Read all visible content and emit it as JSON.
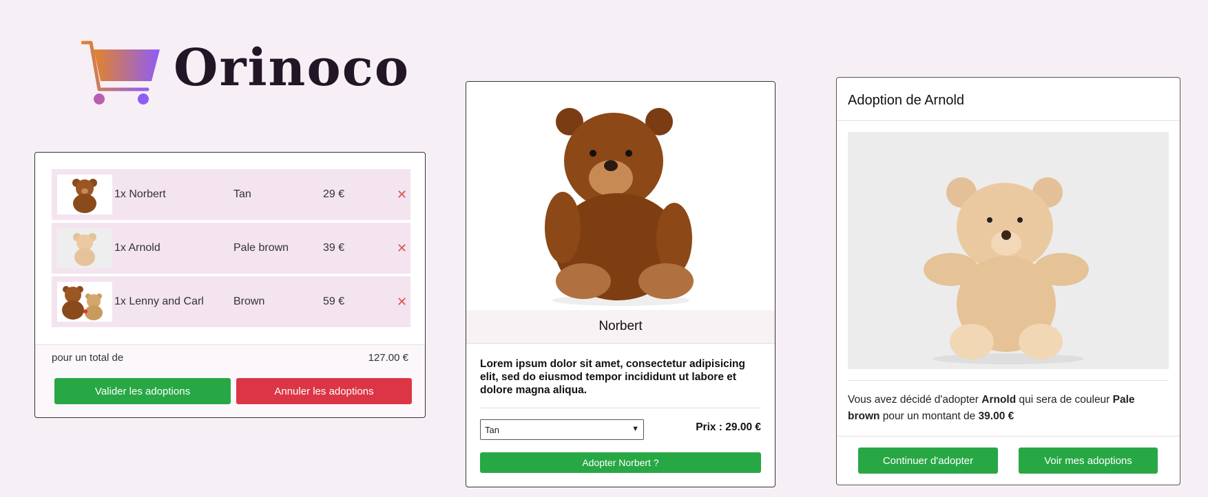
{
  "brand": {
    "name": "Orinoco"
  },
  "cart": {
    "items": [
      {
        "label": "1x Norbert",
        "color": "Tan",
        "price": "29 €",
        "remove": "✕"
      },
      {
        "label": "1x Arnold",
        "color": "Pale brown",
        "price": "39 €",
        "remove": "✕"
      },
      {
        "label": "1x Lenny and Carl",
        "color": "Brown",
        "price": "59 €",
        "remove": "✕"
      }
    ],
    "total_label": "pour un total de",
    "total_value": "127.00 €",
    "validate_label": "Valider les adoptions",
    "cancel_label": "Annuler les adoptions"
  },
  "product": {
    "name": "Norbert",
    "description": "Lorem ipsum dolor sit amet, consectetur adipisicing elit, sed do eiusmod tempor incididunt ut labore et dolore magna aliqua.",
    "selected_color": "Tan",
    "price_text": "Prix : 29.00 €",
    "adopt_label": "Adopter Norbert ?"
  },
  "confirmation": {
    "title": "Adoption de Arnold",
    "text_before": "Vous avez décidé d'adopter ",
    "bear_name": "Arnold",
    "text_mid": " qui sera de couleur ",
    "bear_color": "Pale brown",
    "text_mid2": " pour un montant de ",
    "amount": "39.00 €",
    "continue_label": "Continuer d'adopter",
    "view_label": "Voir mes adoptions"
  },
  "colors": {
    "background": "#f6eff6",
    "success": "#28a745",
    "danger": "#dc3545",
    "cart_row": "#f3e4ef"
  }
}
